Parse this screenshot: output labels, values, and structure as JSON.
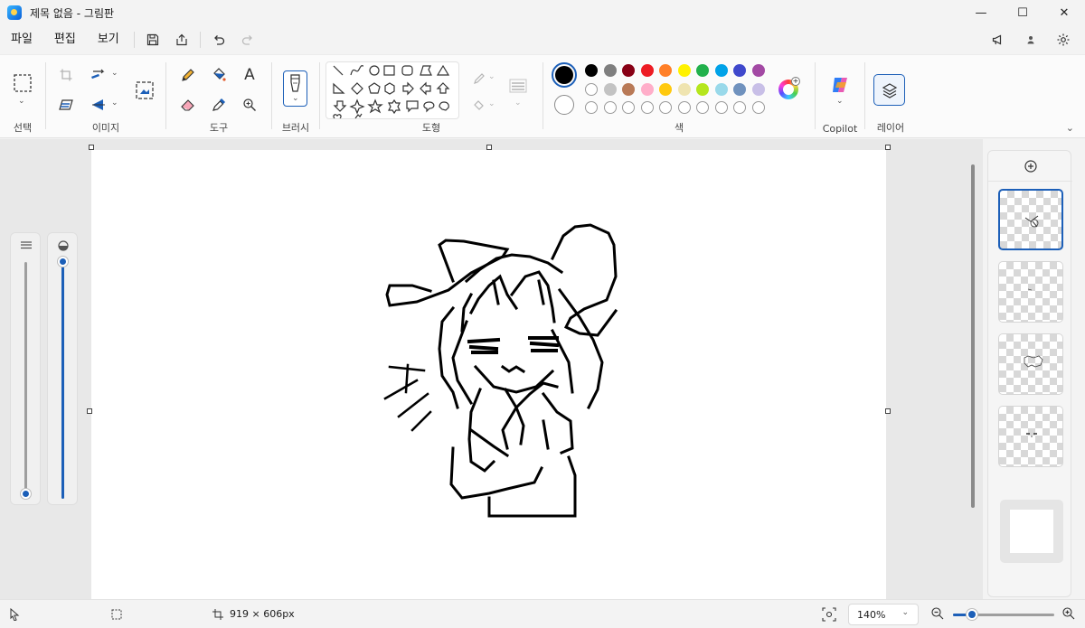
{
  "window": {
    "title": "제목 없음 - 그림판",
    "minimize_glyph": "—",
    "maximize_glyph": "☐",
    "close_glyph": "✕"
  },
  "menu": {
    "file": "파일",
    "edit": "편집",
    "view": "보기"
  },
  "ribbon": {
    "groups": {
      "select": "선택",
      "image": "이미지",
      "tools": "도구",
      "brush": "브러시",
      "shapes": "도형",
      "colors": "색",
      "copilot": "Copilot",
      "layers": "레이어"
    },
    "text_tool_glyph": "A",
    "primary_color": "#000000",
    "secondary_color": "#ffffff",
    "palette_row1": [
      "#000000",
      "#7f7f7f",
      "#880015",
      "#ed1c24",
      "#ff7f27",
      "#fff200",
      "#22b14c",
      "#00a2e8",
      "#3f48cc",
      "#a349a4"
    ],
    "palette_row2": [
      "#ffffff",
      "#c3c3c3",
      "#b97a57",
      "#ffaec9",
      "#ffc90e",
      "#efe4b0",
      "#b5e61d",
      "#99d9ea",
      "#7092be",
      "#c8bfe7"
    ],
    "palette_row3_count": 10
  },
  "status": {
    "canvas_size": "919 × 606px",
    "zoom": "140%",
    "zoom_level": 0.2
  },
  "side_sliders": {
    "size_level": 0.02,
    "opacity_level": 1.0
  },
  "layers": {
    "count": 5,
    "selected_index": 0
  }
}
